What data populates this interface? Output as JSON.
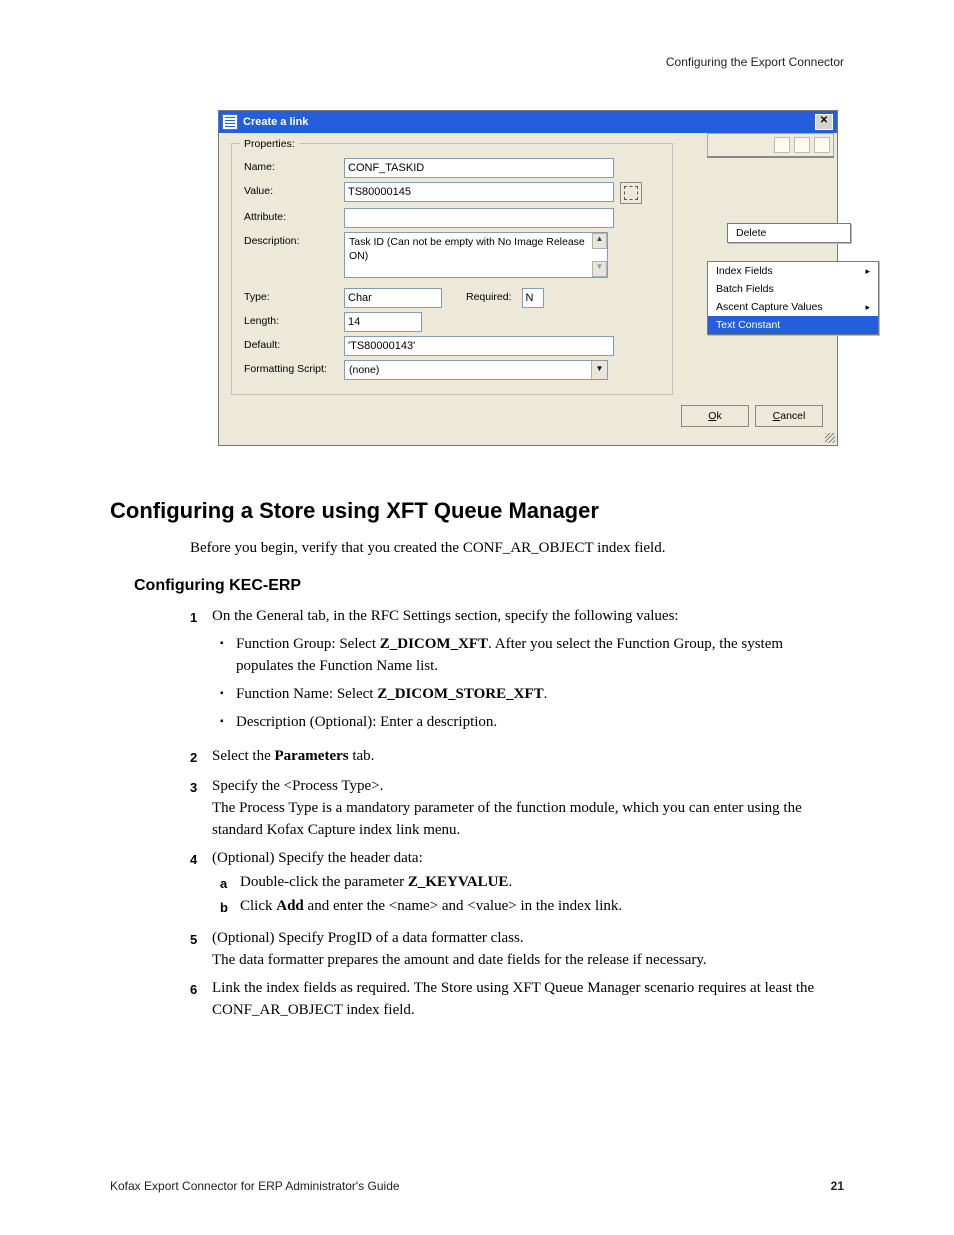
{
  "header": {
    "right": "Configuring the Export Connector"
  },
  "footer": {
    "left": "Kofax Export Connector for ERP Administrator's Guide",
    "page": "21"
  },
  "dialog": {
    "title": "Create a link",
    "close_glyph": "✕",
    "groupbox": "Properties:",
    "labels": {
      "name": "Name:",
      "value": "Value:",
      "attribute": "Attribute:",
      "description": "Description:",
      "type": "Type:",
      "required": "Required:",
      "length": "Length:",
      "default": "Default:",
      "formatting": "Formatting Script:"
    },
    "fields": {
      "name": "CONF_TASKID",
      "value": "TS80000145",
      "attribute": "",
      "description": "Task ID (Can not be empty with No Image Release ON)",
      "type": "Char",
      "required": "N",
      "length": "14",
      "default": "'TS80000143'",
      "formatting": "(none)"
    },
    "buttons": {
      "ok": "Ok",
      "cancel": "Cancel"
    }
  },
  "context": {
    "menu1": {
      "delete": "Delete"
    },
    "menu2": {
      "index_fields": "Index Fields",
      "batch_fields": "Batch Fields",
      "ascent": "Ascent Capture Values",
      "text_constant": "Text Constant"
    }
  },
  "doc": {
    "h2": "Configuring a Store using XFT Queue Manager",
    "intro": "Before you begin, verify that you created the CONF_AR_OBJECT index field.",
    "h3": "Configuring KEC-ERP",
    "step1_lead": "On the General tab, in the RFC Settings section, specify the following values:",
    "b1a_pre": "Function Group: Select  ",
    "b1a_bold": "Z_DICOM_XFT",
    "b1a_post": ". After you select the Function Group, the system populates the Function Name list.",
    "b1b_pre": "Function Name: Select  ",
    "b1b_bold": "Z_DICOM_STORE_XFT",
    "b1b_post": ".",
    "b1c": "Description (Optional): Enter a description.",
    "step2_pre": "Select the ",
    "step2_bold": "Parameters",
    "step2_post": " tab.",
    "step3a": "Specify the <Process Type>.",
    "step3b": "The Process Type is a mandatory parameter of the function module, which you can enter using the standard Kofax Capture index link menu.",
    "step4": "(Optional) Specify the header data:",
    "s4a_pre": "Double-click the parameter ",
    "s4a_bold": "Z_KEYVALUE",
    "s4a_post": ".",
    "s4b_pre": "Click ",
    "s4b_bold": "Add",
    "s4b_post": " and enter the <name> and <value> in the index link.",
    "step5a": "(Optional) Specify ProgID of a data formatter class.",
    "step5b": "The data formatter prepares the amount and date fields for the release if necessary.",
    "step6": "Link the index fields as required. The Store using XFT Queue Manager scenario requires at least the CONF_AR_OBJECT index field."
  }
}
